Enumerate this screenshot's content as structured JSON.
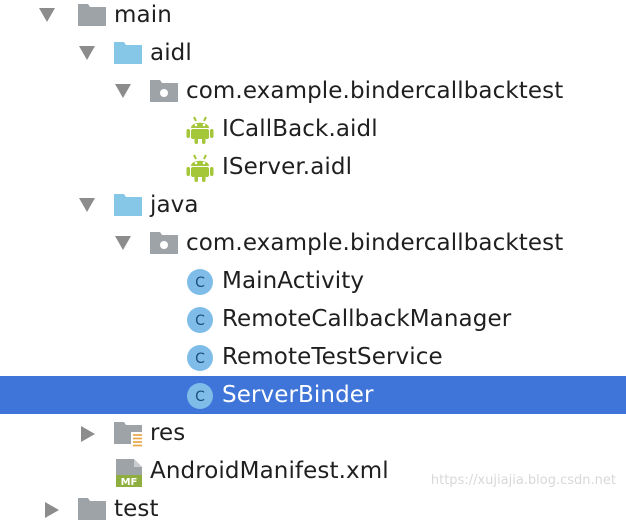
{
  "colors": {
    "selection": "#3f74d8",
    "folder_blue": "#86c6e6",
    "folder_gray": "#9ea3a8",
    "android_green": "#a4c639",
    "class_circle": "#7fbde8",
    "class_letter": "#1c4d7a",
    "arrow": "#8c8c8c"
  },
  "tree": {
    "main": {
      "label": "main",
      "icon": "folder-gray-icon",
      "state": "expanded"
    },
    "aidl": {
      "label": "aidl",
      "icon": "folder-blue-icon",
      "state": "expanded"
    },
    "aidl_pkg": {
      "label": "com.example.bindercallbacktest",
      "icon": "package-icon",
      "state": "expanded"
    },
    "icallback": {
      "label": "ICallBack.aidl",
      "icon": "android-icon"
    },
    "iserver": {
      "label": "IServer.aidl",
      "icon": "android-icon"
    },
    "java": {
      "label": "java",
      "icon": "folder-blue-icon",
      "state": "expanded"
    },
    "java_pkg": {
      "label": "com.example.bindercallbacktest",
      "icon": "package-icon",
      "state": "expanded"
    },
    "main_activity": {
      "label": "MainActivity",
      "icon": "class-icon",
      "icon_letter": "C"
    },
    "remote_callback_manager": {
      "label": "RemoteCallbackManager",
      "icon": "class-icon",
      "icon_letter": "C"
    },
    "remote_test_service": {
      "label": "RemoteTestService",
      "icon": "class-icon",
      "icon_letter": "C"
    },
    "server_binder": {
      "label": "ServerBinder",
      "icon": "class-icon",
      "icon_letter": "C",
      "selected": true
    },
    "res": {
      "label": "res",
      "icon": "resource-folder-icon",
      "state": "collapsed"
    },
    "manifest": {
      "label": "AndroidManifest.xml",
      "icon": "manifest-icon",
      "icon_letter": "MF"
    },
    "next_partial": {
      "label": "test",
      "icon": "folder-gray-icon",
      "state": "collapsed"
    }
  },
  "watermark": "https://xujiajia.blog.csdn.net"
}
